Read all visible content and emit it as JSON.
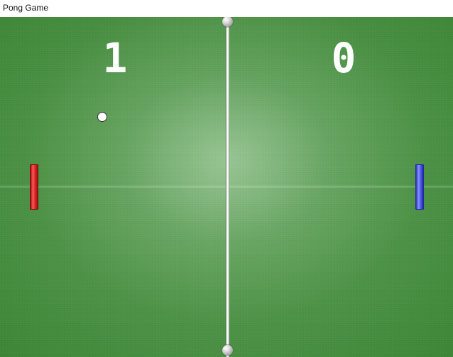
{
  "window": {
    "title": "Pong Game"
  },
  "scoreboard": {
    "left_score": "1",
    "right_score": "0"
  },
  "colors": {
    "court_green": "#3f8938",
    "left_paddle": "#e32d2d",
    "right_paddle": "#5967ef",
    "ball": "#ffffff",
    "net": "#ffffff"
  },
  "icons": {
    "net_cap_top": "net-cap-icon",
    "net_cap_bottom": "net-cap-icon"
  }
}
